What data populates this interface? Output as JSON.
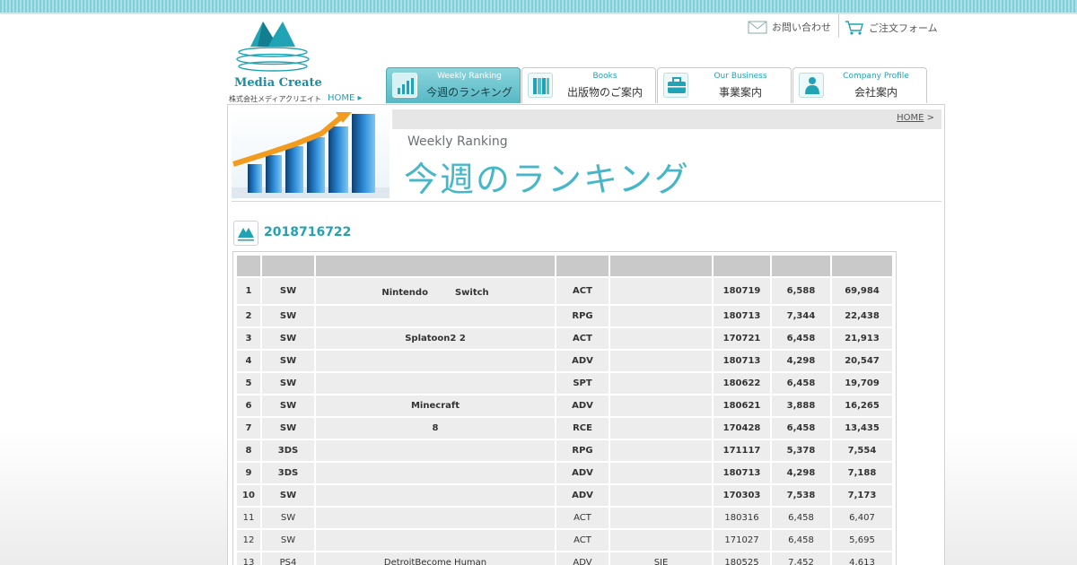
{
  "brand": {
    "name": "Media Create",
    "company": "株式会社メディアクリエイト",
    "home_label": "HOME ▸"
  },
  "util_links": {
    "contact": "お問い合わせ",
    "order": "ご注文フォーム"
  },
  "tabs": [
    {
      "en": "Weekly Ranking",
      "jp": "今週のランキング",
      "active": true
    },
    {
      "en": "Books",
      "jp": "出版物のご案内",
      "active": false
    },
    {
      "en": "Our Business",
      "jp": "事業案内",
      "active": false
    },
    {
      "en": "Company Profile",
      "jp": "会社案内",
      "active": false
    }
  ],
  "breadcrumb": {
    "home": "HOME",
    "sep": ">"
  },
  "hero": {
    "en": "Weekly Ranking",
    "jp": "今週のランキング"
  },
  "section_title": "2018716722",
  "table": {
    "headers": [
      "",
      "",
      "",
      "",
      "",
      "",
      "",
      ""
    ],
    "rows": [
      [
        "1",
        "SW",
        "Nintendo　　　Switch",
        "ACT",
        "",
        "180719",
        "6,588",
        "69,984"
      ],
      [
        "2",
        "SW",
        "",
        "RPG",
        "",
        "180713",
        "7,344",
        "22,438"
      ],
      [
        "3",
        "SW",
        "Splatoon2 2",
        "ACT",
        "",
        "170721",
        "6,458",
        "21,913"
      ],
      [
        "4",
        "SW",
        "",
        "ADV",
        "",
        "180713",
        "4,298",
        "20,547"
      ],
      [
        "5",
        "SW",
        "",
        "SPT",
        "",
        "180622",
        "6,458",
        "19,709"
      ],
      [
        "6",
        "SW",
        "Minecraft",
        "ADV",
        "",
        "180621",
        "3,888",
        "16,265"
      ],
      [
        "7",
        "SW",
        "8",
        "RCE",
        "",
        "170428",
        "6,458",
        "13,435"
      ],
      [
        "8",
        "3DS",
        "",
        "RPG",
        "",
        "171117",
        "5,378",
        "7,554"
      ],
      [
        "9",
        "3DS",
        "",
        "ADV",
        "",
        "180713",
        "4,298",
        "7,188"
      ],
      [
        "10",
        "SW",
        "",
        "ADV",
        "",
        "170303",
        "7,538",
        "7,173"
      ],
      [
        "11",
        "SW",
        "",
        "ACT",
        "",
        "180316",
        "6,458",
        "6,407"
      ],
      [
        "12",
        "SW",
        "",
        "ACT",
        "",
        "171027",
        "6,458",
        "5,695"
      ],
      [
        "13",
        "PS4",
        "DetroitBecome Human",
        "ADV",
        "SIE",
        "180525",
        "7,452",
        "4,613"
      ]
    ],
    "top_count": 10
  },
  "colors": {
    "accent": "#1fa3b5",
    "header_cell": "#c9c9c9",
    "body_cell": "#ededed"
  }
}
